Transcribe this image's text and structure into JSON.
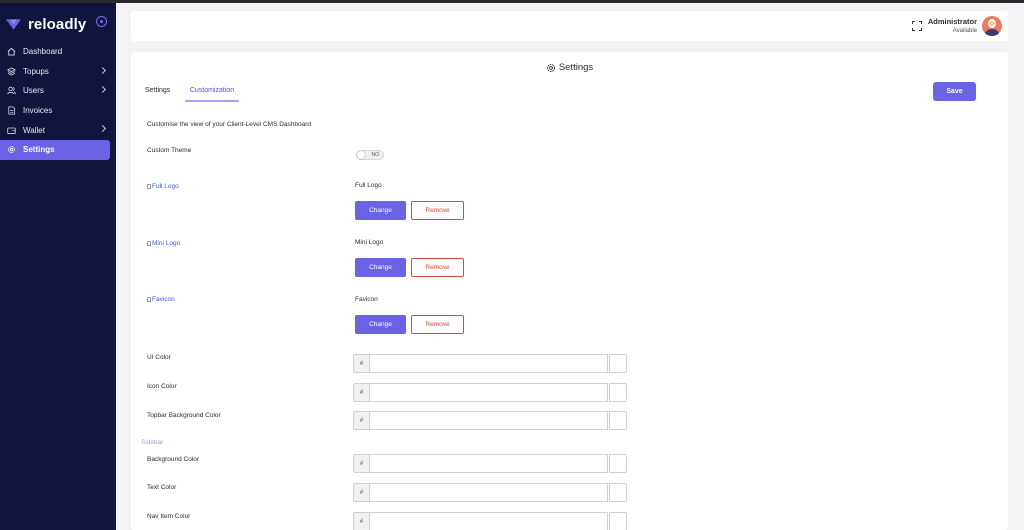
{
  "app": {
    "brand_name": "reloadly",
    "brand_color": "#6b63e6"
  },
  "sidebar": {
    "items": [
      {
        "label": "Dashboard",
        "icon": "home-icon",
        "has_submenu": false,
        "active": false
      },
      {
        "label": "Topups",
        "icon": "topups-icon",
        "has_submenu": true,
        "active": false
      },
      {
        "label": "Users",
        "icon": "users-icon",
        "has_submenu": true,
        "active": false
      },
      {
        "label": "Invoices",
        "icon": "invoice-icon",
        "has_submenu": false,
        "active": false
      },
      {
        "label": "Wallet",
        "icon": "wallet-icon",
        "has_submenu": true,
        "active": false
      },
      {
        "label": "Settings",
        "icon": "gear-icon",
        "has_submenu": false,
        "active": true
      }
    ]
  },
  "topbar": {
    "user_name": "Administrator",
    "user_status": "Available"
  },
  "page": {
    "title": "Settings",
    "tabs": [
      {
        "label": "Settings",
        "active": false
      },
      {
        "label": "Customization",
        "active": true
      }
    ],
    "save_label": "Save",
    "description": "Customise the view of your Client-Level CMS Dashboard",
    "custom_theme": {
      "label": "Custom Theme",
      "toggle_text": "NO",
      "enabled": false
    },
    "assets": [
      {
        "image_alt": "Full Logo",
        "name": "Full Logo",
        "change_label": "Change",
        "remove_label": "Remove"
      },
      {
        "image_alt": "Mini Logo",
        "name": "Mini Logo",
        "change_label": "Change",
        "remove_label": "Remove"
      },
      {
        "image_alt": "Favicon",
        "name": "Favicon",
        "change_label": "Change",
        "remove_label": "Remove"
      }
    ],
    "colors": [
      {
        "label": "UI Color",
        "prefix": "#",
        "value": ""
      },
      {
        "label": "Icon Color",
        "prefix": "#",
        "value": ""
      },
      {
        "label": "Topbar Background Color",
        "prefix": "#",
        "value": ""
      }
    ],
    "sidebar_section_label": "Sidebar",
    "sidebar_colors": [
      {
        "label": "Background Color",
        "prefix": "#",
        "value": ""
      },
      {
        "label": "Text Color",
        "prefix": "#",
        "value": ""
      },
      {
        "label": "Nav Item Color",
        "prefix": "#",
        "value": ""
      }
    ]
  }
}
